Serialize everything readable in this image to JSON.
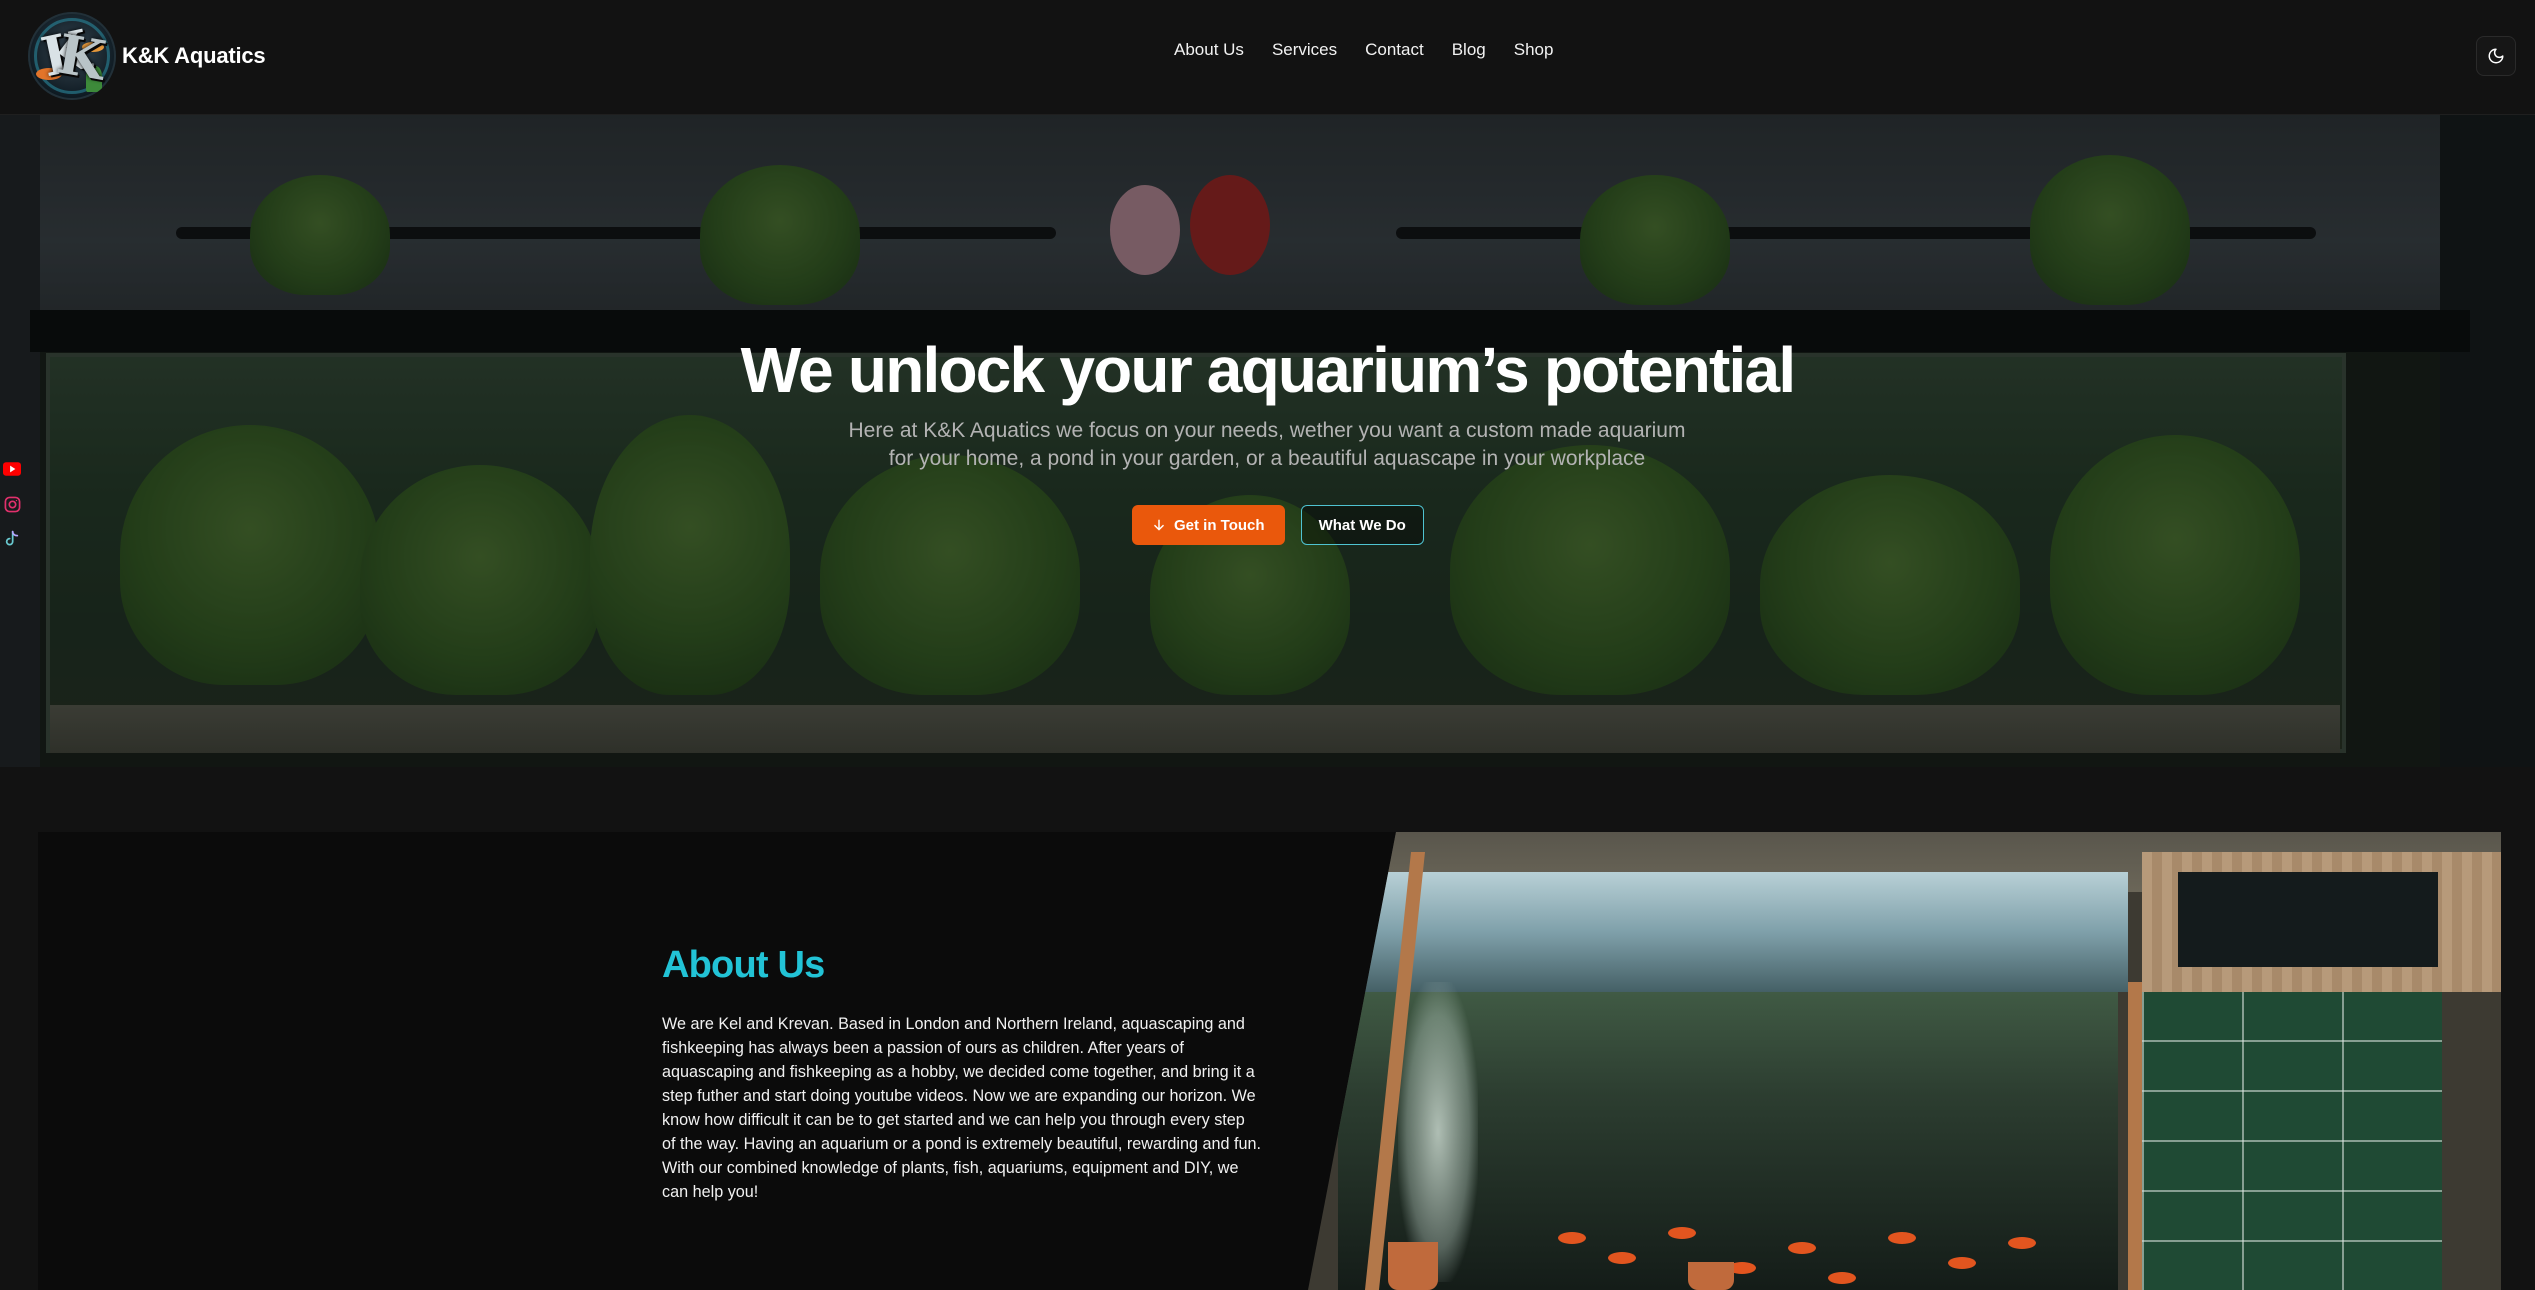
{
  "header": {
    "brand_name": "K&K Aquatics",
    "logo_icon": "kk-aquatics-logo",
    "nav": [
      {
        "label": "About Us"
      },
      {
        "label": "Services"
      },
      {
        "label": "Contact"
      },
      {
        "label": "Blog"
      },
      {
        "label": "Shop"
      }
    ],
    "theme_toggle_icon": "moon-icon"
  },
  "hero": {
    "title": "We unlock your aquarium’s potential",
    "subtitle_line1": "Here at K&K Aquatics we focus on your needs, wether you want a custom made aquarium",
    "subtitle_line2": "for your home, a pond in your garden, or a beautiful aquascape in your workplace",
    "primary_button": {
      "label": "Get in Touch",
      "icon": "arrow-down-icon"
    },
    "secondary_button": {
      "label": "What We Do"
    }
  },
  "social": [
    {
      "icon": "youtube-icon",
      "color": "#ff0000"
    },
    {
      "icon": "instagram-icon",
      "color": "#e1306c"
    },
    {
      "icon": "tiktok-icon",
      "color": "#69c9d0"
    }
  ],
  "about": {
    "title": "About Us",
    "text": "We are Kel and Krevan. Based in London and Northern Ireland, aquascaping and fishkeeping has always been a passion of ours as children. After years of aquascaping and fishkeeping as a hobby, we decided come together, and bring it a step futher and start doing youtube videos. Now we are expanding our horizon. We know how difficult it can be to get started and we can help you through every step of the way. Having an aquarium or a pond is extremely beautiful, rewarding and fun. With our combined knowledge of plants, fish, aquariums, equipment and DIY, we can help you!"
  },
  "colors": {
    "accent_orange": "#ea580c",
    "accent_cyan": "#22c3d6",
    "background": "#121212"
  }
}
